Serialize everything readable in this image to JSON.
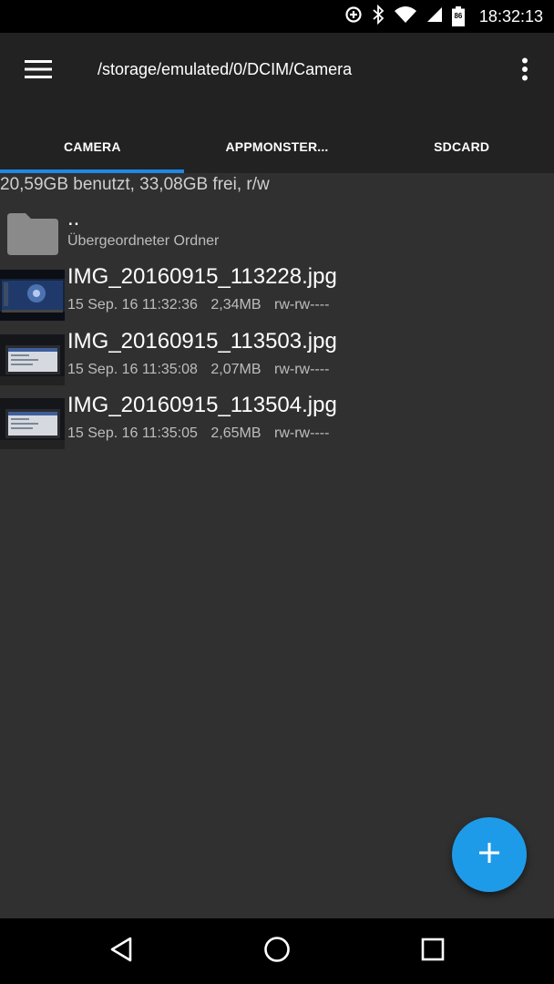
{
  "status_bar": {
    "time": "18:32:13",
    "battery_level": "86"
  },
  "app_bar": {
    "path": "/storage/emulated/0/DCIM/Camera"
  },
  "tabs": [
    {
      "label": "CAMERA",
      "active": true
    },
    {
      "label": "APPMONSTER...",
      "active": false
    },
    {
      "label": "SDCARD",
      "active": false
    }
  ],
  "storage_info": "20,59GB benutzt, 33,08GB frei, r/w",
  "parent_folder": {
    "name": "..",
    "description": "Übergeordneter Ordner"
  },
  "files": [
    {
      "name": "IMG_20160915_113228.jpg",
      "date": "15 Sep. 16 11:32:36",
      "size": "2,34MB",
      "permissions": "rw-rw----"
    },
    {
      "name": "IMG_20160915_113503.jpg",
      "date": "15 Sep. 16 11:35:08",
      "size": "2,07MB",
      "permissions": "rw-rw----"
    },
    {
      "name": "IMG_20160915_113504.jpg",
      "date": "15 Sep. 16 11:35:05",
      "size": "2,65MB",
      "permissions": "rw-rw----"
    }
  ],
  "colors": {
    "accent": "#1e88e5",
    "fab": "#1e9be8",
    "background": "#303030",
    "app_bar": "#222222"
  }
}
